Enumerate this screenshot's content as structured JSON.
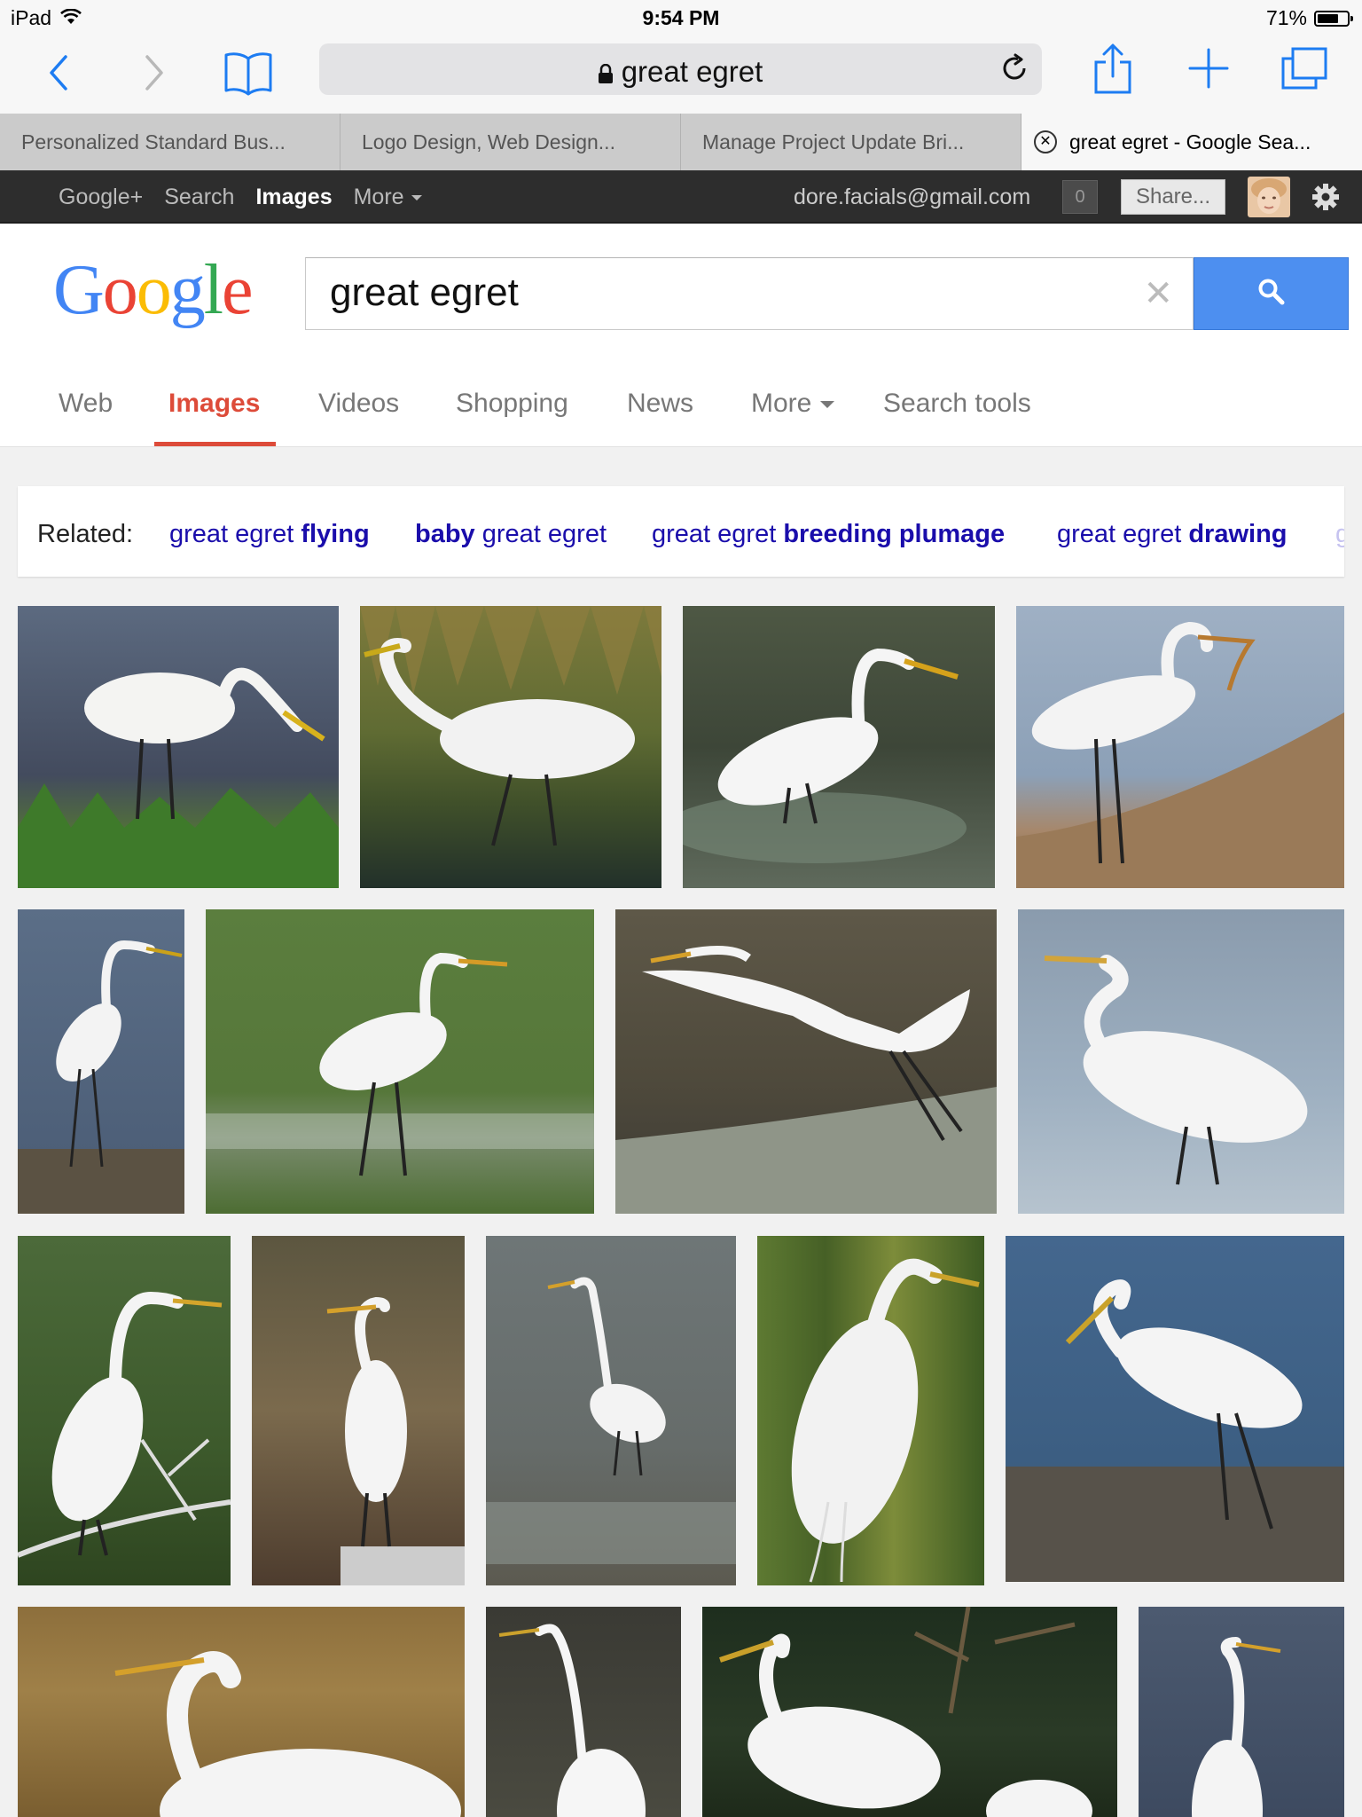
{
  "status_bar": {
    "device": "iPad",
    "time": "9:54 PM",
    "battery": "71%",
    "battery_level": 0.71
  },
  "safari": {
    "address": "great egret"
  },
  "tabs": [
    {
      "title": "Personalized Standard Bus..."
    },
    {
      "title": "Logo Design, Web Design..."
    },
    {
      "title": "Manage Project Update Bri..."
    },
    {
      "title": "great egret - Google Sea..."
    }
  ],
  "google_bar": {
    "links": [
      "Google+",
      "Search",
      "Images",
      "More"
    ],
    "email": "dore.facials@gmail.com",
    "notifications": "0",
    "share": "Share..."
  },
  "search": {
    "logo": "Google",
    "query": "great egret"
  },
  "search_tabs": [
    "Web",
    "Images",
    "Videos",
    "Shopping",
    "News",
    "More",
    "Search tools"
  ],
  "related": {
    "label": "Related:",
    "items": [
      {
        "plain": "great egret ",
        "bold": "flying"
      },
      {
        "bold": "baby",
        "plain": " great egret"
      },
      {
        "plain": "great egret ",
        "bold": "breeding plumage"
      },
      {
        "plain": "great egret ",
        "bold": "drawing"
      }
    ],
    "truncated": "g"
  },
  "colors": {
    "accent_red": "#dd4b39",
    "link_blue": "#1a0dab",
    "search_blue": "#4d8ff0"
  }
}
